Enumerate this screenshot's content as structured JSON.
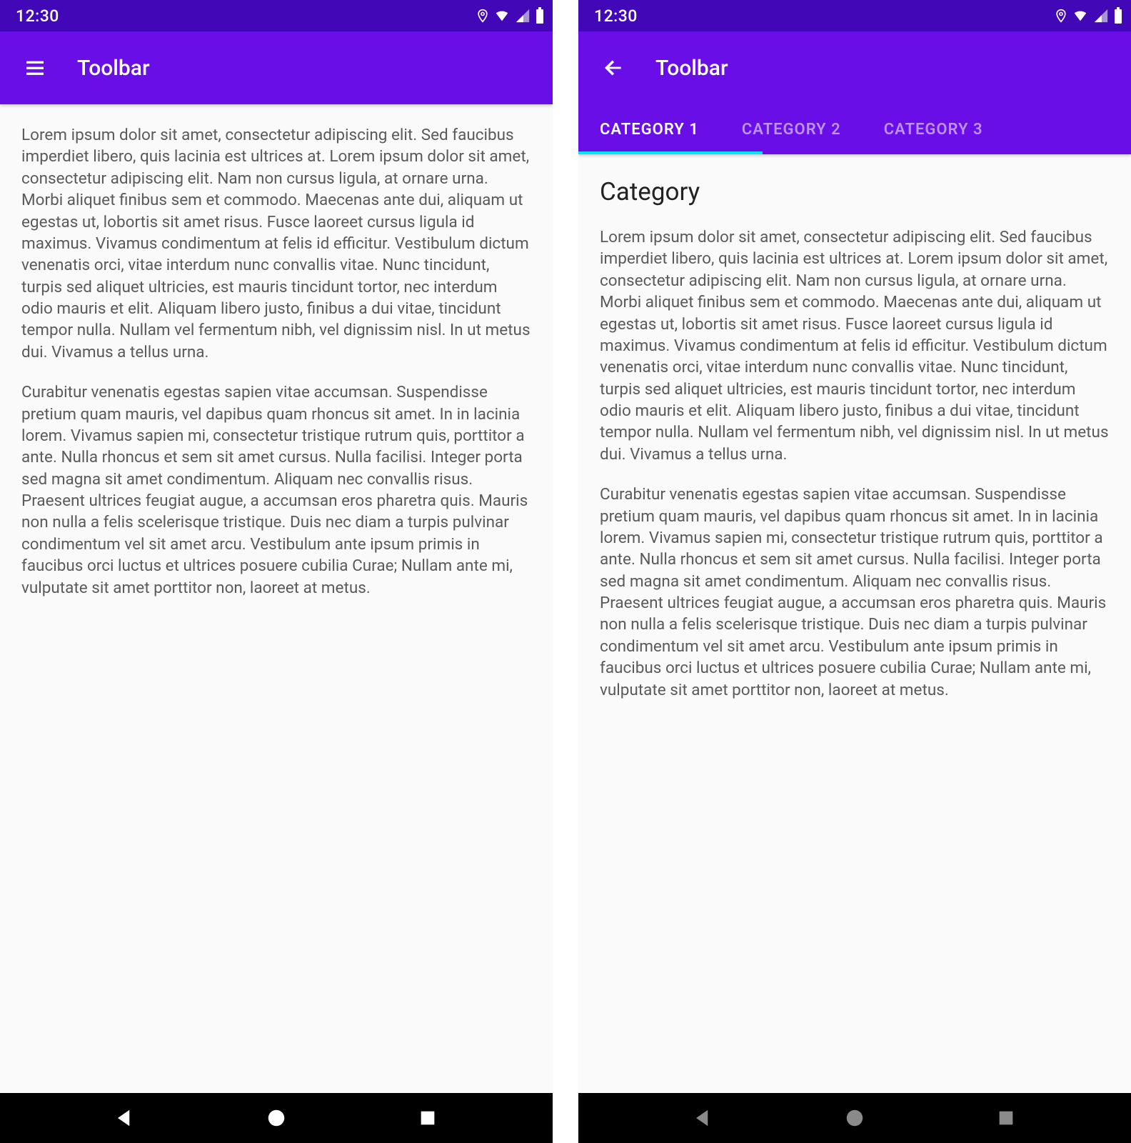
{
  "status": {
    "time": "12:30"
  },
  "left": {
    "toolbar_title": "Toolbar",
    "para1": "Lorem ipsum dolor sit amet, consectetur adipiscing elit. Sed faucibus imperdiet libero, quis lacinia est ultrices at. Lorem ipsum dolor sit amet, consectetur adipiscing elit. Nam non cursus ligula, at ornare urna. Morbi aliquet finibus sem et commodo. Maecenas ante dui, aliquam ut egestas ut, lobortis sit amet risus. Fusce laoreet cursus ligula id maximus. Vivamus condimentum at felis id efficitur. Vestibulum dictum venenatis orci, vitae interdum nunc convallis vitae. Nunc tincidunt, turpis sed aliquet ultricies, est mauris tincidunt tortor, nec interdum odio mauris et elit. Aliquam libero justo, finibus a dui vitae, tincidunt tempor nulla. Nullam vel fermentum nibh, vel dignissim nisl. In ut metus dui. Vivamus a tellus urna.",
    "para2": "Curabitur venenatis egestas sapien vitae accumsan. Suspendisse pretium quam mauris, vel dapibus quam rhoncus sit amet. In in lacinia lorem. Vivamus sapien mi, consectetur tristique rutrum quis, porttitor a ante. Nulla rhoncus et sem sit amet cursus. Nulla facilisi. Integer porta sed magna sit amet condimentum. Aliquam nec convallis risus. Praesent ultrices feugiat augue, a accumsan eros pharetra quis. Mauris non nulla a felis scelerisque tristique. Duis nec diam a turpis pulvinar condimentum vel sit amet arcu. Vestibulum ante ipsum primis in faucibus orci luctus et ultrices posuere cubilia Curae; Nullam ante mi, vulputate sit amet porttitor non, laoreet at metus."
  },
  "right": {
    "toolbar_title": "Toolbar",
    "tabs": [
      "CATEGORY 1",
      "CATEGORY 2",
      "CATEGORY 3"
    ],
    "active_tab_index": 0,
    "heading": "Category",
    "para1": "Lorem ipsum dolor sit amet, consectetur adipiscing elit. Sed faucibus imperdiet libero, quis lacinia est ultrices at. Lorem ipsum dolor sit amet, consectetur adipiscing elit. Nam non cursus ligula, at ornare urna. Morbi aliquet finibus sem et commodo. Maecenas ante dui, aliquam ut egestas ut, lobortis sit amet risus. Fusce laoreet cursus ligula id maximus. Vivamus condimentum at felis id efficitur. Vestibulum dictum venenatis orci, vitae interdum nunc convallis vitae. Nunc tincidunt, turpis sed aliquet ultricies, est mauris tincidunt tortor, nec interdum odio mauris et elit. Aliquam libero justo, finibus a dui vitae, tincidunt tempor nulla. Nullam vel fermentum nibh, vel dignissim nisl. In ut metus dui. Vivamus a tellus urna.",
    "para2": "Curabitur venenatis egestas sapien vitae accumsan. Suspendisse pretium quam mauris, vel dapibus quam rhoncus sit amet. In in lacinia lorem. Vivamus sapien mi, consectetur tristique rutrum quis, porttitor a ante. Nulla rhoncus et sem sit amet cursus. Nulla facilisi. Integer porta sed magna sit amet condimentum. Aliquam nec convallis risus. Praesent ultrices feugiat augue, a accumsan eros pharetra quis. Mauris non nulla a felis scelerisque tristique. Duis nec diam a turpis pulvinar condimentum vel sit amet arcu. Vestibulum ante ipsum primis in faucibus orci luctus et ultrices posuere cubilia Curae; Nullam ante mi, vulputate sit amet porttitor non, laoreet at metus."
  },
  "colors": {
    "status_bar": "#4207B6",
    "toolbar": "#6A0EE7",
    "tab_indicator": "#00E5FF"
  }
}
